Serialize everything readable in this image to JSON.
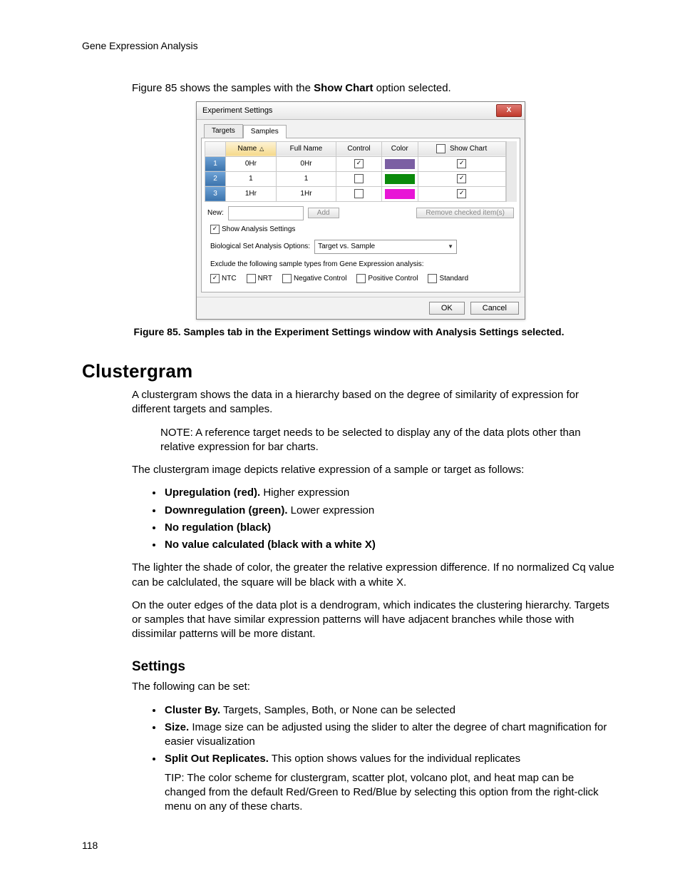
{
  "header": {
    "running": "Gene Expression Analysis"
  },
  "introLine": {
    "pre": "Figure 85 shows the samples with the ",
    "bold": "Show Chart",
    "post": " option selected."
  },
  "dialog": {
    "title": "Experiment Settings",
    "close": "X",
    "tabs": {
      "targets": "Targets",
      "samples": "Samples"
    },
    "columns": {
      "name": "Name",
      "fullName": "Full Name",
      "control": "Control",
      "color": "Color",
      "showChart": "Show Chart"
    },
    "rows": [
      {
        "n": "1",
        "name": "0Hr",
        "full": "0Hr",
        "control": true,
        "color": "#7b5fa3",
        "chart": true
      },
      {
        "n": "2",
        "name": "1",
        "full": "1",
        "control": false,
        "color": "#0b8a0b",
        "chart": true
      },
      {
        "n": "3",
        "name": "1Hr",
        "full": "1Hr",
        "control": false,
        "color": "#e815d6",
        "chart": true
      }
    ],
    "newLabel": "New:",
    "addBtn": "Add",
    "removeBtn": "Remove checked item(s)",
    "showAnalysis": "Show Analysis Settings",
    "bioSetLabel": "Biological Set Analysis Options:",
    "bioSetValue": "Target vs. Sample",
    "excludeLabel": "Exclude the following sample types from Gene Expression analysis:",
    "excludes": {
      "ntc": "NTC",
      "nrt": "NRT",
      "neg": "Negative Control",
      "pos": "Positive Control",
      "std": "Standard"
    },
    "ok": "OK",
    "cancel": "Cancel"
  },
  "figCaption": "Figure 85. Samples tab in the Experiment Settings window with Analysis Settings selected.",
  "sectionTitle": "Clustergram",
  "clust": {
    "p1": "A clustergram shows the data in a hierarchy based on the degree of similarity of expression for different targets and samples.",
    "note": "NOTE: A reference target needs to be selected to display any of the data plots other than relative expression for bar charts.",
    "p2": "The clustergram image depicts relative expression of a sample or target as follows:",
    "bullets": [
      {
        "b": "Upregulation (red).",
        "t": " Higher expression"
      },
      {
        "b": "Downregulation (green).",
        "t": " Lower expression"
      },
      {
        "b": "No regulation (black)",
        "t": ""
      },
      {
        "b": "No value calculated (black with a white X)",
        "t": ""
      }
    ],
    "p3": "The lighter the shade of color, the greater the relative expression difference. If no normalized Cq value can be calclulated, the square will be black with a white X.",
    "p4": "On the outer edges of the data plot is a dendrogram, which indicates the clustering hierarchy. Targets or samples that have similar expression patterns will have adjacent branches while those with dissimilar patterns will be more distant."
  },
  "settingsTitle": "Settings",
  "settings": {
    "intro": "The following can be set:",
    "items": [
      {
        "b": "Cluster By.",
        "t": " Targets, Samples, Both, or None can be selected"
      },
      {
        "b": "Size.",
        "t": " Image size can be adjusted using the slider to alter the degree of chart magnification for easier visualization"
      },
      {
        "b": "Split Out Replicates.",
        "t": " This option shows values for the individual replicates"
      }
    ],
    "tip": "TIP: The color scheme for clustergram, scatter plot, volcano plot, and heat map can be changed from the default Red/Green to Red/Blue by selecting this option from the right-click menu on any of these charts."
  },
  "pageNumber": "118"
}
